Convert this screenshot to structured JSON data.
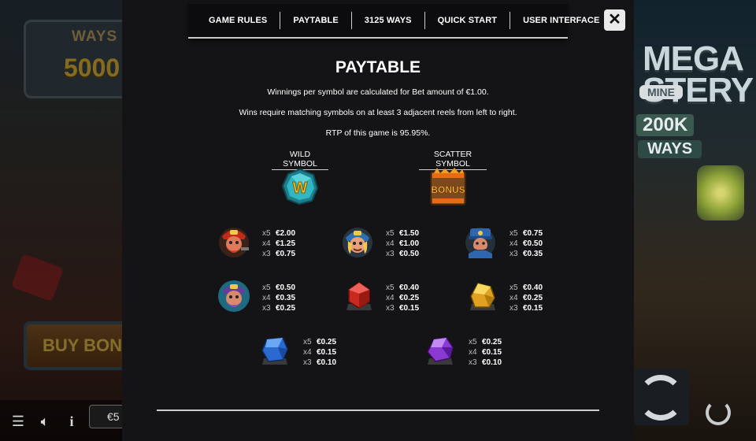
{
  "background": {
    "ways_sign": {
      "label": "WAYS",
      "value": "5000"
    },
    "buy_bonus": "BUY BON",
    "balance_prefix": "€5",
    "game_title": "MEGA\nSTERY",
    "mine_label": "MINE",
    "jackpot": "200K",
    "ways_right": "WAYS"
  },
  "tabs": [
    "GAME RULES",
    "PAYTABLE",
    "3125 WAYS",
    "QUICK START",
    "USER INTERFACE"
  ],
  "close_label": "✕",
  "title": "PAYTABLE",
  "descriptions": [
    "Winnings per symbol are calculated for Bet amount of €1.00.",
    "Wins require matching symbols on at least 3 adjacent reels from left to right.",
    "RTP of this game is 95.95%."
  ],
  "wild": {
    "heading": "WILD SYMBOL",
    "letter": "W"
  },
  "scatter": {
    "heading": "SCATTER SYMBOL",
    "letter": "BONUS"
  },
  "symbols": [
    {
      "name": "red-miner",
      "pays": [
        [
          "x5",
          "€2.00"
        ],
        [
          "x4",
          "€1.25"
        ],
        [
          "x3",
          "€0.75"
        ]
      ]
    },
    {
      "name": "blonde-miner",
      "pays": [
        [
          "x5",
          "€1.50"
        ],
        [
          "x4",
          "€1.00"
        ],
        [
          "x3",
          "€0.50"
        ]
      ]
    },
    {
      "name": "blue-miner",
      "pays": [
        [
          "x5",
          "€0.75"
        ],
        [
          "x4",
          "€0.50"
        ],
        [
          "x3",
          "€0.35"
        ]
      ]
    },
    {
      "name": "purple-miner",
      "pays": [
        [
          "x5",
          "€0.50"
        ],
        [
          "x4",
          "€0.35"
        ],
        [
          "x3",
          "€0.25"
        ]
      ]
    },
    {
      "name": "red-gem",
      "pays": [
        [
          "x5",
          "€0.40"
        ],
        [
          "x4",
          "€0.25"
        ],
        [
          "x3",
          "€0.15"
        ]
      ]
    },
    {
      "name": "gold-gem",
      "pays": [
        [
          "x5",
          "€0.40"
        ],
        [
          "x4",
          "€0.25"
        ],
        [
          "x3",
          "€0.15"
        ]
      ]
    },
    {
      "name": "blue-gem",
      "pays": [
        [
          "x5",
          "€0.25"
        ],
        [
          "x4",
          "€0.15"
        ],
        [
          "x3",
          "€0.10"
        ]
      ]
    },
    {
      "name": "purple-gem",
      "pays": [
        [
          "x5",
          "€0.25"
        ],
        [
          "x4",
          "€0.15"
        ],
        [
          "x3",
          "€0.10"
        ]
      ]
    }
  ],
  "colors": {
    "panel": "#141416",
    "text": "#ffffff",
    "wild": "#2fb8c4",
    "scatter": "#e07a1c"
  }
}
